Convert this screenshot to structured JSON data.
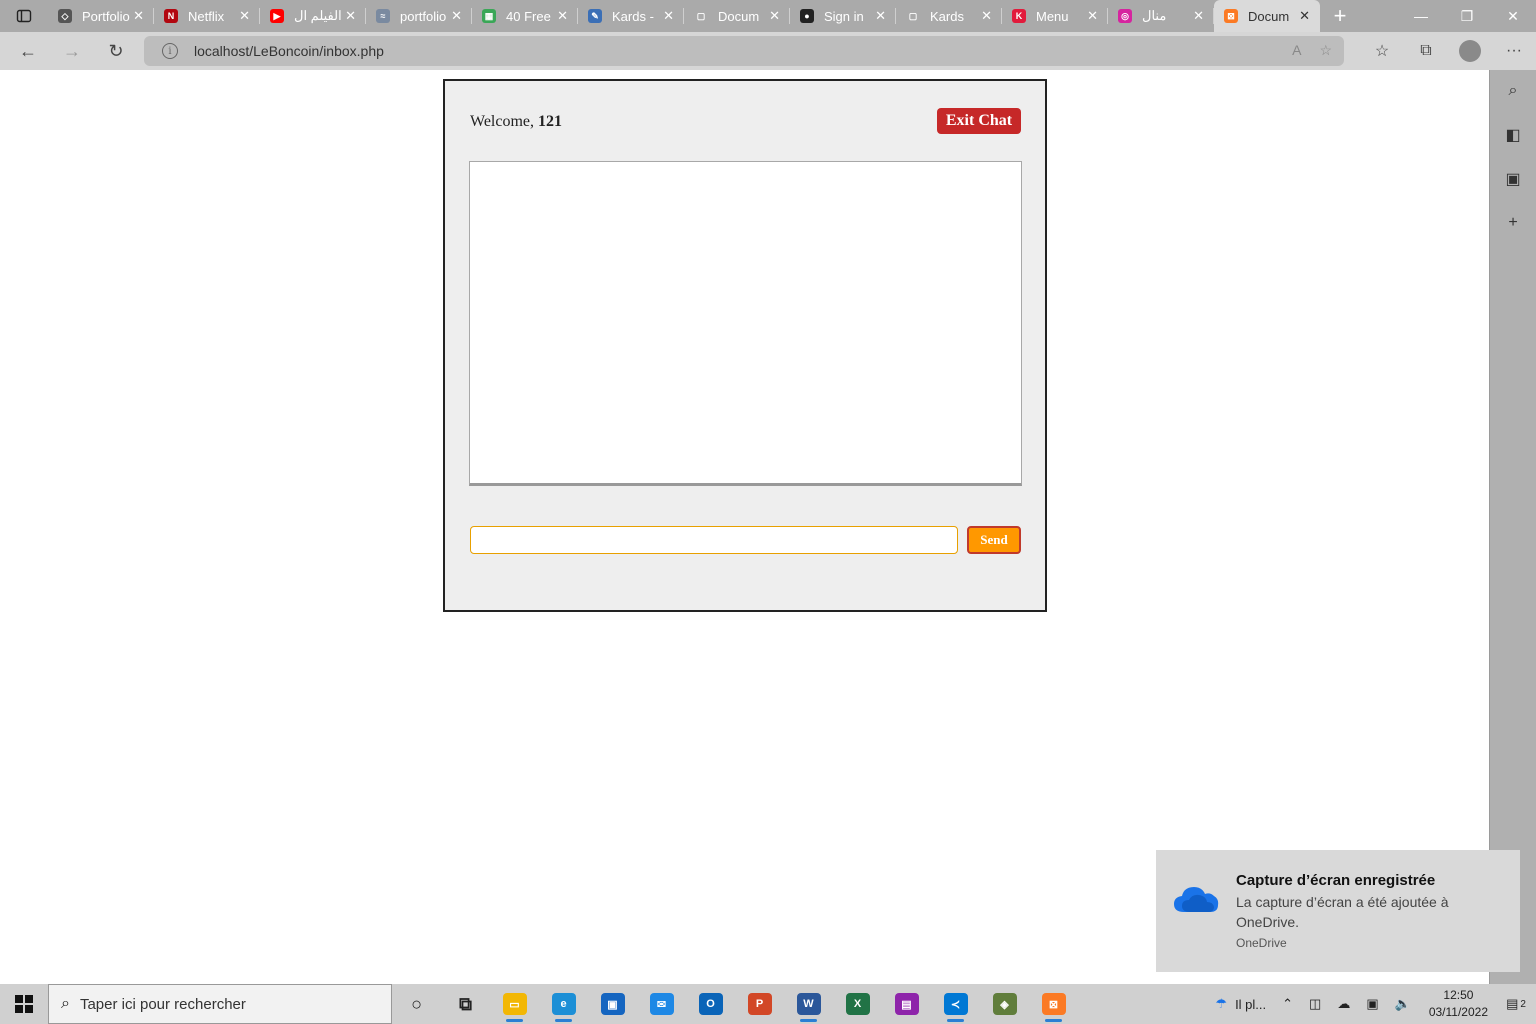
{
  "browser": {
    "tabs": [
      {
        "title": "Portfolio",
        "icon": "codepen-icon",
        "color": "#555555",
        "glyph": "◇"
      },
      {
        "title": "Netflix",
        "icon": "netflix-icon",
        "color": "#b20710",
        "glyph": "N"
      },
      {
        "title": "الفيلم ال",
        "icon": "youtube-icon",
        "color": "#ff0000",
        "glyph": "▶"
      },
      {
        "title": "portfolio",
        "icon": "generic-icon",
        "color": "#7a8aa0",
        "glyph": "≈"
      },
      {
        "title": "40 Free",
        "icon": "sheet-icon",
        "color": "#3aa757",
        "glyph": "▦"
      },
      {
        "title": "Kards -",
        "icon": "kards-icon",
        "color": "#3b6fb6",
        "glyph": "✎"
      },
      {
        "title": "Docum",
        "icon": "document-icon",
        "color": "#aaaaaa",
        "glyph": "▢"
      },
      {
        "title": "Sign in",
        "icon": "github-icon",
        "color": "#222222",
        "glyph": "●"
      },
      {
        "title": "Kards",
        "icon": "document-icon",
        "color": "#aaaaaa",
        "glyph": "▢"
      },
      {
        "title": "Menu",
        "icon": "kahoot-icon",
        "color": "#e21b3c",
        "glyph": "K"
      },
      {
        "title": "منال",
        "icon": "instagram-icon",
        "color": "#d6249f",
        "glyph": "◎"
      },
      {
        "title": "Docum",
        "icon": "xampp-icon",
        "color": "#fb7a24",
        "glyph": "⊠",
        "active": true
      }
    ],
    "url": "localhost/LeBoncoin/inbox.php"
  },
  "chat": {
    "welcome_prefix": "Welcome, ",
    "username": "121",
    "exit_label": "Exit Chat",
    "send_label": "Send",
    "message_value": ""
  },
  "toast": {
    "title": "Capture d’écran enregistrée",
    "body": "La capture d’écran a été ajoutée à OneDrive.",
    "source": "OneDrive"
  },
  "taskbar": {
    "search_placeholder": "Taper ici pour rechercher",
    "apps": [
      {
        "name": "cortana-icon",
        "color": "transparent",
        "glyph": "○",
        "running": false
      },
      {
        "name": "task-view-icon",
        "color": "transparent",
        "glyph": "⧉",
        "running": false
      },
      {
        "name": "file-explorer-icon",
        "color": "#f2b705",
        "glyph": "▭",
        "running": true
      },
      {
        "name": "edge-icon",
        "color": "#1c8fd6",
        "glyph": "e",
        "running": true
      },
      {
        "name": "store-icon",
        "color": "#1565c0",
        "glyph": "▣",
        "running": false
      },
      {
        "name": "mail-icon",
        "color": "#1e88e5",
        "glyph": "✉",
        "running": false
      },
      {
        "name": "outlook-icon",
        "color": "#0a64b8",
        "glyph": "O",
        "running": false
      },
      {
        "name": "powerpoint-icon",
        "color": "#d24726",
        "glyph": "P",
        "running": false
      },
      {
        "name": "word-icon",
        "color": "#2b579a",
        "glyph": "W",
        "running": true
      },
      {
        "name": "excel-icon",
        "color": "#217346",
        "glyph": "X",
        "running": false
      },
      {
        "name": "winrar-icon",
        "color": "#8e24aa",
        "glyph": "▤",
        "running": false
      },
      {
        "name": "vscode-icon",
        "color": "#0078d4",
        "glyph": "≺",
        "running": true
      },
      {
        "name": "bandizip-icon",
        "color": "#607d3b",
        "glyph": "◈",
        "running": false
      },
      {
        "name": "xampp-icon",
        "color": "#fb7a24",
        "glyph": "⊠",
        "running": true
      }
    ],
    "weather_text": "Il pl...",
    "time": "12:50",
    "date": "03/11/2022",
    "notification_count": "2"
  }
}
